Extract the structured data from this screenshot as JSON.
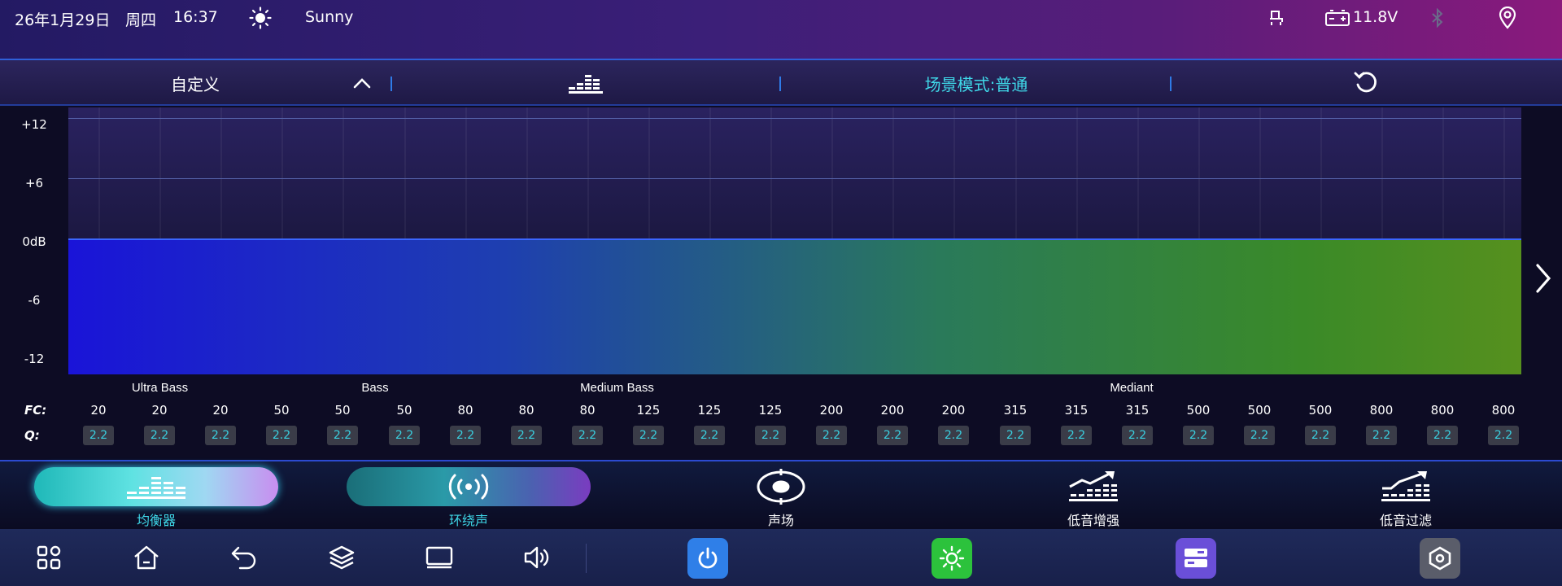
{
  "status": {
    "datetime": "26年1月29日",
    "weekday": "周四",
    "time": "16:37",
    "weather": "Sunny",
    "battery_voltage": "11.8V",
    "icons": [
      "weather-sun-icon",
      "seat-icon",
      "battery-icon",
      "bluetooth-icon",
      "location-pin-icon"
    ]
  },
  "toolbar": {
    "preset": "自定义",
    "scene_mode": "场景模式:普通",
    "icons": [
      "chevron-up-icon",
      "equalizer-icon",
      "reset-icon"
    ]
  },
  "eq": {
    "y_labels": [
      "+12",
      "+6",
      "0dB",
      "-6",
      "-12"
    ],
    "level_db": 0,
    "bands": [
      {
        "label": "Ultra Bass",
        "color": "#1a1aff"
      },
      {
        "label": "Bass",
        "color": "#1856ff"
      },
      {
        "label": "Medium Bass",
        "color": "#1aa0f0"
      },
      {
        "label": "Mediant",
        "color": "#3cc832"
      }
    ],
    "fc_label": "FC:",
    "q_label": "Q:",
    "fc_values": [
      "20",
      "20",
      "20",
      "50",
      "50",
      "50",
      "80",
      "80",
      "80",
      "125",
      "125",
      "125",
      "200",
      "200",
      "200",
      "315",
      "315",
      "315",
      "500",
      "500",
      "500",
      "800",
      "800",
      "800"
    ],
    "q_values": [
      "2.2",
      "2.2",
      "2.2",
      "2.2",
      "2.2",
      "2.2",
      "2.2",
      "2.2",
      "2.2",
      "2.2",
      "2.2",
      "2.2",
      "2.2",
      "2.2",
      "2.2",
      "2.2",
      "2.2",
      "2.2",
      "2.2",
      "2.2",
      "2.2",
      "2.2",
      "2.2",
      "2.2"
    ]
  },
  "modes": [
    {
      "label": "均衡器",
      "icon": "equalizer-icon",
      "active": true
    },
    {
      "label": "环绕声",
      "icon": "surround-icon",
      "active": false
    },
    {
      "label": "声场",
      "icon": "sound-field-icon",
      "active": false
    },
    {
      "label": "低音增强",
      "icon": "bass-boost-icon",
      "active": false
    },
    {
      "label": "低音过滤",
      "icon": "bass-filter-icon",
      "active": false
    }
  ],
  "nav": {
    "icons": [
      "apps-grid-icon",
      "home-icon",
      "back-icon",
      "layers-icon",
      "screen-icon",
      "volume-icon"
    ],
    "apps": [
      {
        "icon": "power-icon",
        "color": "#2f7fe8"
      },
      {
        "icon": "brightness-icon",
        "color": "#2cc23c"
      },
      {
        "icon": "storage-icon",
        "color": "#6a4fd8"
      },
      {
        "icon": "settings-hex-icon",
        "color": "#5a5d6a"
      }
    ]
  }
}
